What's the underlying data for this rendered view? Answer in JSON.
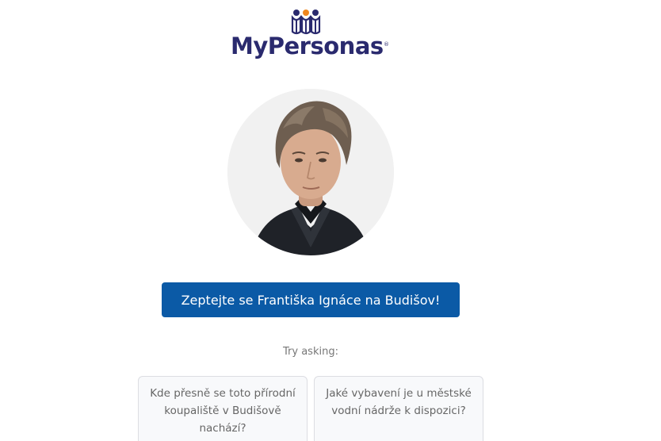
{
  "brand": {
    "name": "MyPersonas",
    "registered_mark": "®",
    "colors": {
      "navy": "#2a2a6e",
      "orange": "#f0871e"
    }
  },
  "persona": {
    "avatar_icon": "portrait-photo"
  },
  "cta": {
    "label": "Zeptejte se Františka Ignáce na Budišov!",
    "color": "#0b5aa6"
  },
  "suggestions": {
    "heading": "Try asking:",
    "items": [
      {
        "text": "Kde přesně se toto přírodní koupaliště v Budišově nachází?"
      },
      {
        "text": "Jaké vybavení je u městské vodní nádrže k dispozici?"
      }
    ]
  }
}
